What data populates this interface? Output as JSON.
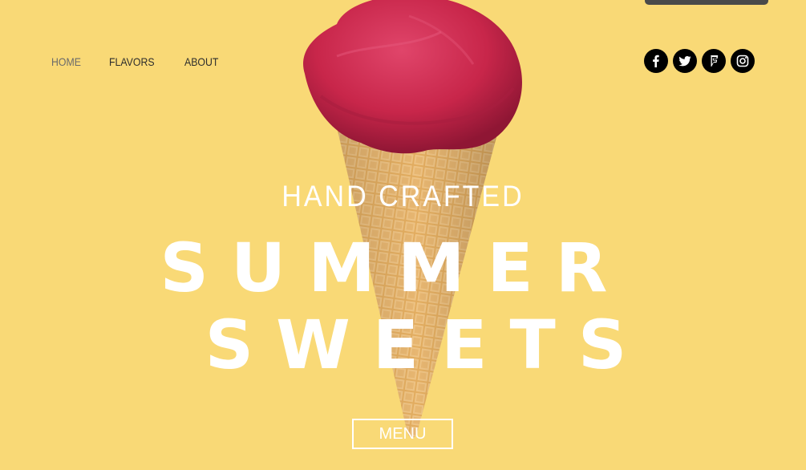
{
  "nav": {
    "items": [
      {
        "label": "HOME",
        "active": true
      },
      {
        "label": "FLAVORS",
        "active": false
      },
      {
        "label": "ABOUT",
        "active": false
      }
    ]
  },
  "social": [
    {
      "icon": "facebook-icon"
    },
    {
      "icon": "twitter-icon"
    },
    {
      "icon": "foursquare-icon"
    },
    {
      "icon": "instagram-icon"
    }
  ],
  "hero": {
    "kicker": "HAND CRAFTED",
    "line1": "SUMMER",
    "line2": "SWEETS",
    "cta": "MENU"
  },
  "colors": {
    "background": "#f9d976",
    "scoop": "#cc2a4e",
    "cone": "#e0a85a",
    "text": "#ffffff"
  }
}
